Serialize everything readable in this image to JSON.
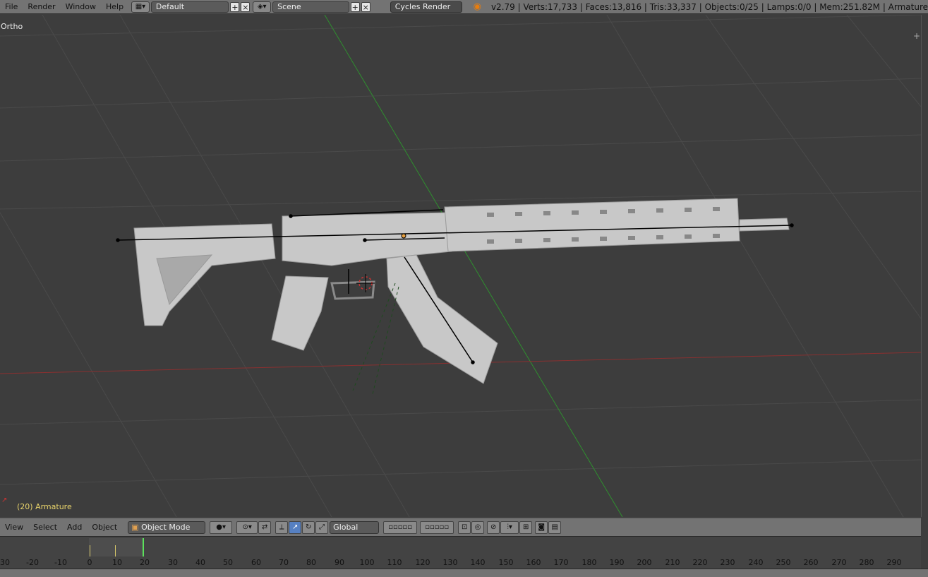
{
  "topbar": {
    "menu": [
      "File",
      "Render",
      "Window",
      "Help"
    ],
    "layout_value": "Default",
    "scene_value": "Scene",
    "engine_value": "Cycles Render",
    "stats": "v2.79 | Verts:17,733 | Faces:13,816 | Tris:33,337 | Objects:0/25 | Lamps:0/0 | Mem:251.82M | Armature"
  },
  "viewport": {
    "view_label": "Ortho",
    "active_object": "(20) Armature"
  },
  "header3d": {
    "menu": [
      "View",
      "Select",
      "Add",
      "Object"
    ],
    "mode_value": "Object Mode",
    "orientation_value": "Global"
  },
  "timeline": {
    "ticks": [
      "30",
      "-20",
      "-10",
      "0",
      "10",
      "20",
      "30",
      "40",
      "50",
      "60",
      "70",
      "80",
      "90",
      "100",
      "110",
      "120",
      "130",
      "140",
      "150",
      "160",
      "170",
      "180",
      "190",
      "200",
      "210",
      "220",
      "230",
      "240",
      "250",
      "260",
      "270",
      "280",
      "290"
    ],
    "current_frame": 20
  },
  "colors": {
    "accent": "#5680c2",
    "frame_marker": "#5ce15c",
    "object_label": "#e8d36b"
  }
}
